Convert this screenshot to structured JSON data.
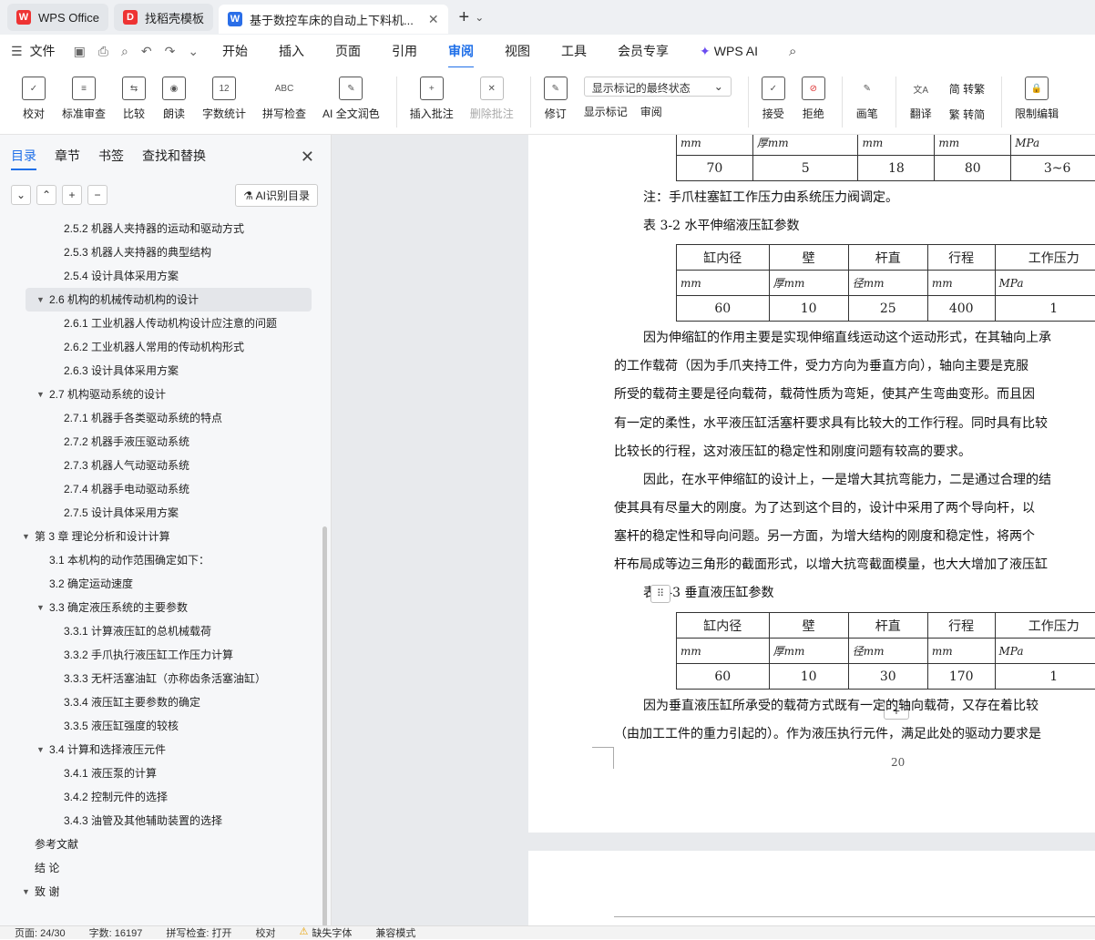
{
  "tabs": [
    {
      "label": "WPS Office",
      "color": "#e33"
    },
    {
      "label": "找稻壳模板",
      "color": "#e33"
    },
    {
      "label": "基于数控车床的自动上下料机...",
      "color": "#2a6ee8"
    }
  ],
  "menu": {
    "file": "文件",
    "items": [
      "开始",
      "插入",
      "页面",
      "引用",
      "审阅",
      "视图",
      "工具",
      "会员专享"
    ],
    "ai": "WPS AI"
  },
  "ribbon": {
    "group1": [
      "校对",
      "标准审查",
      "比较",
      "朗读",
      "字数统计",
      "拼写检查",
      "AI 全文润色"
    ],
    "group2": [
      "插入批注",
      "删除批注"
    ],
    "revise": "修订",
    "markup_select": "显示标记的最终状态",
    "show_markup": "显示标记",
    "review": "审阅",
    "group3": [
      "接受",
      "拒绝"
    ],
    "brush": "画笔",
    "translate": "翻译",
    "to_trad": "简 转繁",
    "to_simp": "繁 转简",
    "restrict": "限制编辑"
  },
  "leftpane": {
    "tabs": [
      "目录",
      "章节",
      "书签",
      "查找和替换"
    ],
    "ai_button": "AI识别目录",
    "toc": [
      {
        "t": "2.5.2 机器人夹持器的运动和驱动方式",
        "l": 3
      },
      {
        "t": "2.5.3  机器人夹持器的典型结构",
        "l": 3
      },
      {
        "t": "2.5.4 设计具体采用方案",
        "l": 3
      },
      {
        "t": "2.6 机构的机械传动机构的设计",
        "l": 2,
        "sel": true,
        "exp": true
      },
      {
        "t": "2.6.1 工业机器人传动机构设计应注意的问题",
        "l": 3
      },
      {
        "t": "2.6.2 工业机器人常用的传动机构形式",
        "l": 3
      },
      {
        "t": "2.6.3  设计具体采用方案",
        "l": 3
      },
      {
        "t": "2.7 机构驱动系统的设计",
        "l": 2,
        "exp": true
      },
      {
        "t": "2.7.1 机器手各类驱动系统的特点",
        "l": 3
      },
      {
        "t": "2.7.2 机器手液压驱动系统",
        "l": 3
      },
      {
        "t": "2.7.3  机器人气动驱动系统",
        "l": 3
      },
      {
        "t": "2.7.4 机器手电动驱动系统",
        "l": 3
      },
      {
        "t": "2.7.5 设计具体采用方案",
        "l": 3
      },
      {
        "t": "第 3 章    理论分析和设计计算",
        "l": 1,
        "exp": true
      },
      {
        "t": "3.1 本机构的动作范围确定如下：",
        "l": 2
      },
      {
        "t": "3.2  确定运动速度",
        "l": 2
      },
      {
        "t": "3.3 确定液压系统的主要参数",
        "l": 2,
        "exp": true
      },
      {
        "t": "3.3.1 计算液压缸的总机械载荷",
        "l": 3
      },
      {
        "t": "3.3.2 手爪执行液压缸工作压力计算",
        "l": 3
      },
      {
        "t": "3.3.3  无杆活塞油缸（亦称齿条活塞油缸）",
        "l": 3
      },
      {
        "t": "3.3.4 液压缸主要参数的确定",
        "l": 3
      },
      {
        "t": "3.3.5 液压缸强度的较核",
        "l": 3
      },
      {
        "t": "3.4 计算和选择液压元件",
        "l": 2,
        "exp": true
      },
      {
        "t": "3.4.1 液压泵的计算",
        "l": 3
      },
      {
        "t": "3.4.2 控制元件的选择",
        "l": 3
      },
      {
        "t": "3.4.3 油管及其他辅助装置的选择",
        "l": 3
      },
      {
        "t": "参考文献",
        "l": 1
      },
      {
        "t": "结    论",
        "l": 1
      },
      {
        "t": "致      谢",
        "l": 1,
        "exp": true
      }
    ]
  },
  "doc": {
    "t1_units": [
      "mm",
      "厚mm",
      "mm",
      "mm",
      "MPa"
    ],
    "t1_vals": [
      "70",
      "5",
      "18",
      "80",
      "3~6"
    ],
    "note": "注：手爪柱塞缸工作压力由系统压力阀调定。",
    "t2_caption": "表 3-2  水平伸缩液压缸参数",
    "headers": [
      "缸内径",
      "壁",
      "杆直",
      "行程",
      "工作压力"
    ],
    "head_sub": [
      "mm",
      "厚mm",
      "径mm",
      "mm",
      "MPa"
    ],
    "t2_vals": [
      "60",
      "10",
      "25",
      "400",
      "1"
    ],
    "para1": [
      "因为伸缩缸的作用主要是实现伸缩直线运动这个运动形式，在其轴向上承",
      "的工作载荷（因为手爪夹持工件，受力方向为垂直方向），轴向主要是克服",
      "所受的载荷主要是径向载荷，载荷性质为弯矩，使其产生弯曲变形。而且因",
      "有一定的柔性，水平液压缸活塞杆要求具有比较大的工作行程。同时具有比较",
      "比较长的行程，这对液压缸的稳定性和刚度问题有较高的要求。"
    ],
    "para2": [
      "因此，在水平伸缩缸的设计上，一是增大其抗弯能力，二是通过合理的结",
      "使其具有尽量大的刚度。为了达到这个目的，设计中采用了两个导向杆，以",
      "塞杆的稳定性和导向问题。另一方面，为增大结构的刚度和稳定性，将两个",
      "杆布局成等边三角形的截面形式，以增大抗弯截面模量，也大大增加了液压缸"
    ],
    "t3_caption": "表 3-3    垂直液压缸参数",
    "t3_vals": [
      "60",
      "10",
      "30",
      "170",
      "1"
    ],
    "para3": [
      "因为垂直液压缸所承受的载荷方式既有一定的轴向载荷，又存在着比较",
      "（由加工工件的重力引起的）。作为液压执行元件，满足此处的驱动力要求是"
    ],
    "page_num": "20"
  },
  "status": {
    "page": "页面: 24/30",
    "words": "字数: 16197",
    "spell": "拼写检查: 打开",
    "proof": "校对",
    "font": "缺失字体",
    "compat": "兼容模式"
  }
}
